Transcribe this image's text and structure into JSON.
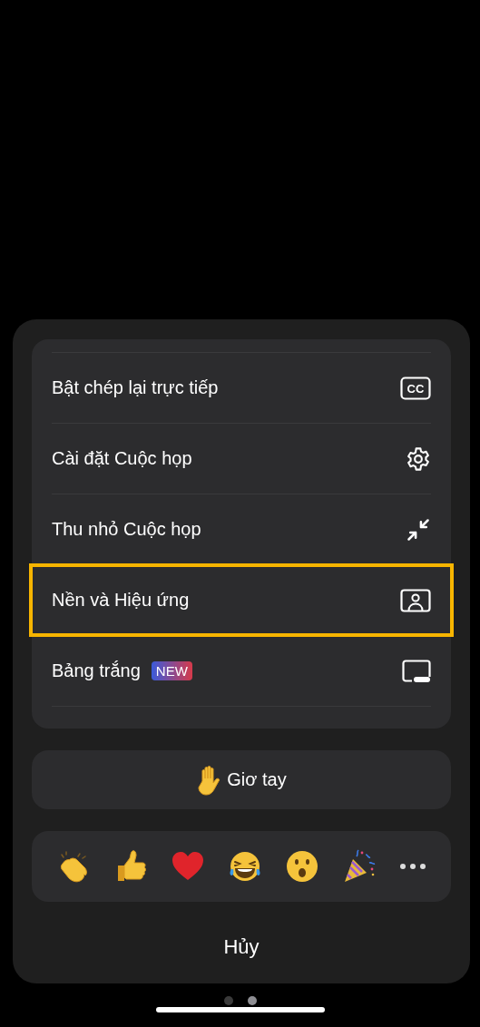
{
  "menu": {
    "items": [
      {
        "label": "Bật chép lại trực tiếp",
        "kind": "cc",
        "icon_text": "CC",
        "highlighted": false
      },
      {
        "label": "Cài đặt Cuộc họp",
        "kind": "gear",
        "highlighted": false
      },
      {
        "label": "Thu nhỏ Cuộc họp",
        "kind": "shrink",
        "highlighted": false
      },
      {
        "label": "Nền và Hiệu ứng",
        "kind": "portrait",
        "highlighted": true
      },
      {
        "label": "Bảng trắng",
        "badge": "NEW",
        "kind": "whiteboard",
        "highlighted": false
      }
    ]
  },
  "raise_hand": {
    "label": "Giơ tay"
  },
  "reactions": [
    {
      "kind": "clap"
    },
    {
      "kind": "thumbs"
    },
    {
      "kind": "heart"
    },
    {
      "kind": "laugh"
    },
    {
      "kind": "wow"
    },
    {
      "kind": "party"
    },
    {
      "kind": "more"
    }
  ],
  "cancel": {
    "label": "Hủy"
  },
  "page_dots": [
    {
      "selected": false
    },
    {
      "selected": true
    }
  ]
}
